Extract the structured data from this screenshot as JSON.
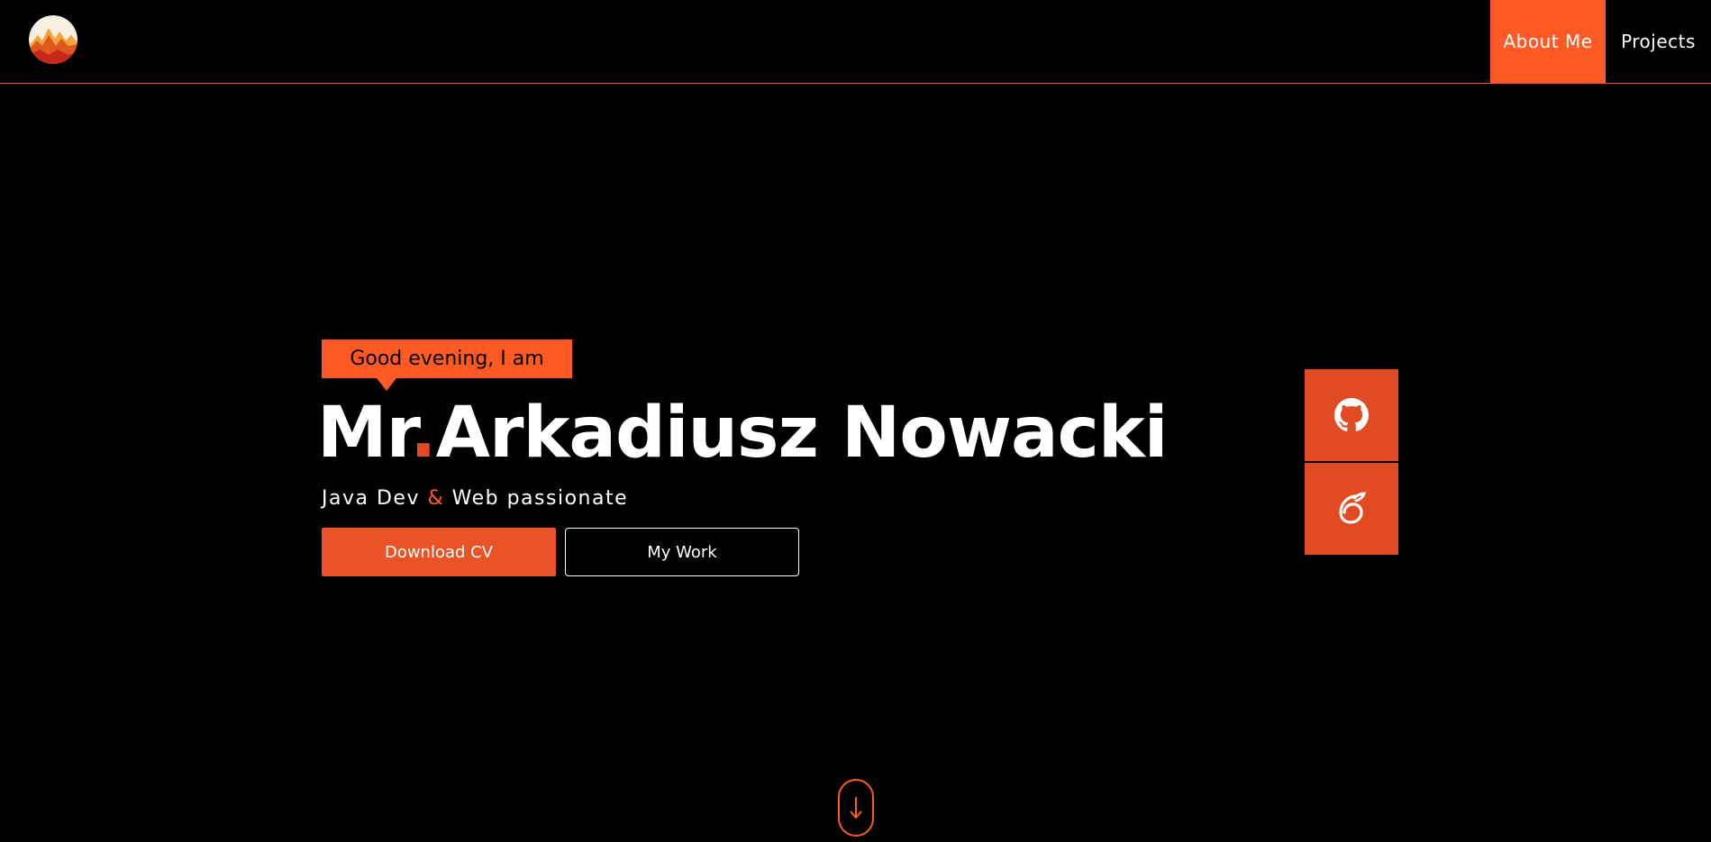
{
  "nav": {
    "items": [
      {
        "label": "About Me"
      },
      {
        "label": "Projects"
      }
    ]
  },
  "hero": {
    "greeting": "Good evening, I am",
    "name_prefix": "Mr",
    "name_dot": ".",
    "name_main": "Arkadiusz Nowacki",
    "tagline_part1": "Java Dev",
    "tagline_amp": "&",
    "tagline_part2": "Web passionate",
    "download_label": "Download CV",
    "work_label": "My Work"
  },
  "social": [
    {
      "icon": "github-icon"
    },
    {
      "icon": "cv-leaf-icon"
    }
  ],
  "scroll": {
    "glyph": "↓"
  },
  "colors": {
    "accent": "#ff5a23",
    "accent_dark": "#e14b23",
    "background": "#000000",
    "text": "#ffffff"
  }
}
